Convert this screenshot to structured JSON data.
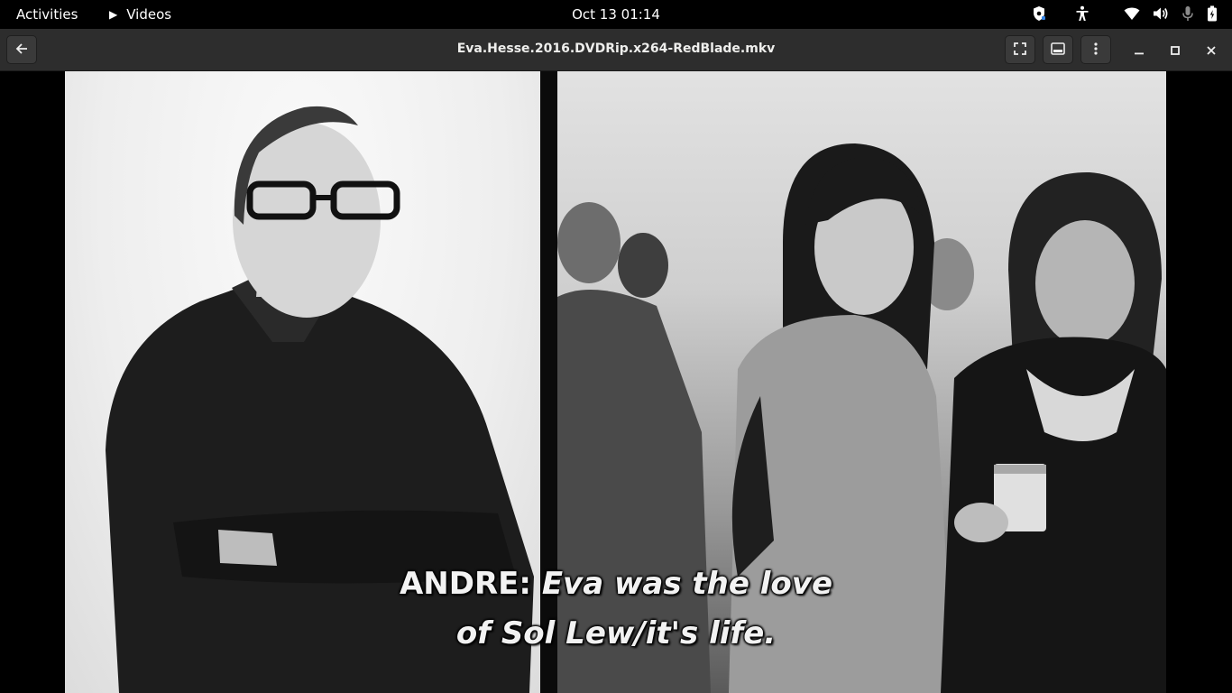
{
  "topbar": {
    "activities_label": "Activities",
    "app_name": "Videos",
    "clock": "Oct 13  01:14",
    "tray_icons": [
      "privacy-shield-icon",
      "accessibility-icon",
      "wifi-icon",
      "volume-icon",
      "microphone-icon",
      "battery-icon"
    ]
  },
  "headerbar": {
    "title": "Eva.Hesse.2016.DVDRip.x264-RedBlade.mkv",
    "buttons": [
      "back-icon",
      "fullscreen-icon",
      "subtitles-icon",
      "menu-icon",
      "minimize-icon",
      "maximize-icon",
      "close-icon"
    ]
  },
  "video": {
    "subtitle_speaker": "ANDRE:",
    "subtitle_line1_rest": "Eva was the love",
    "subtitle_line2": "of Sol Lew/it's life."
  }
}
